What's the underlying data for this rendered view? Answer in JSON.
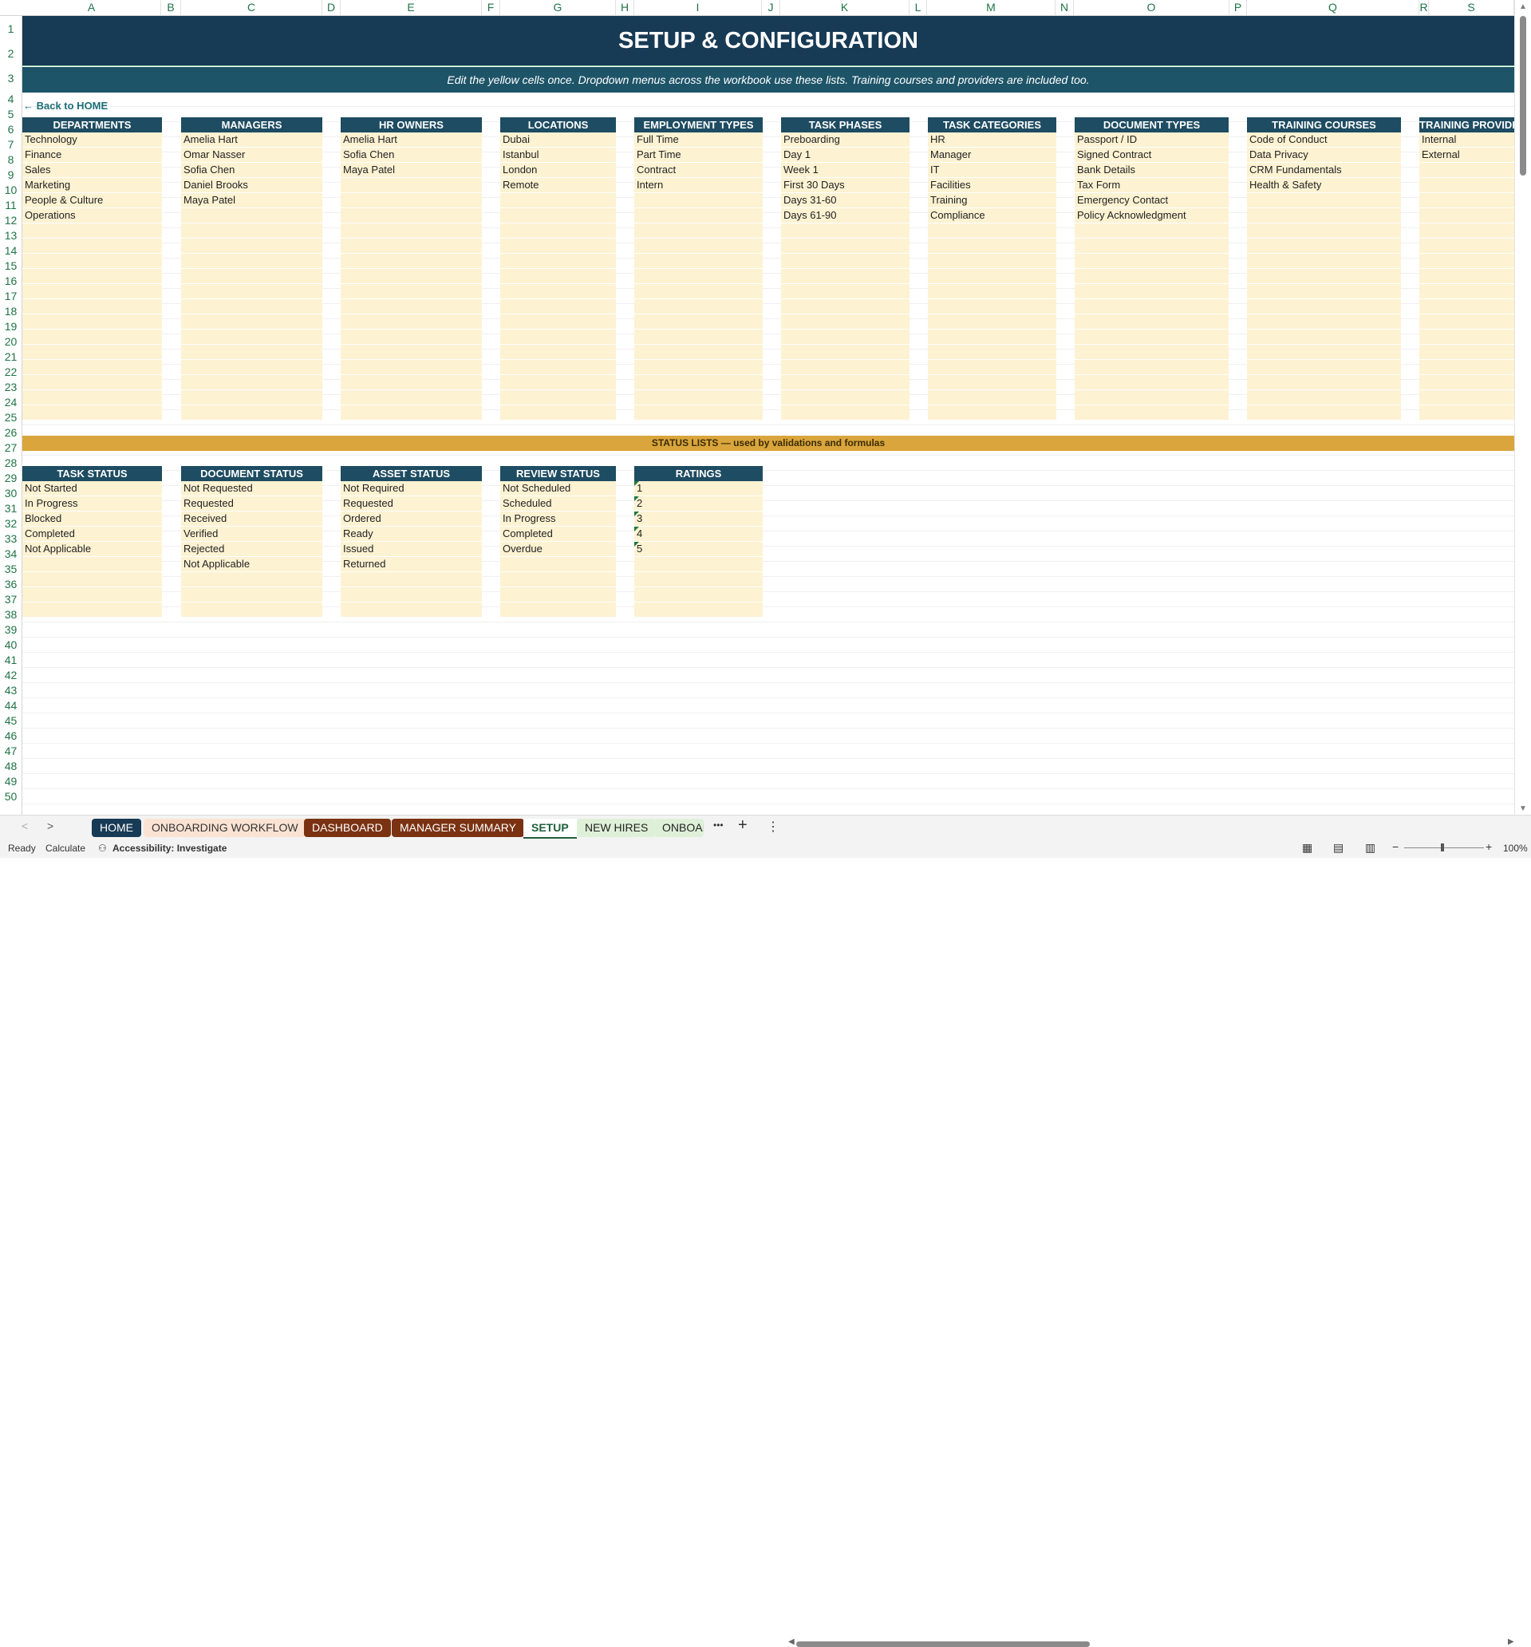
{
  "columns": [
    "A",
    "B",
    "C",
    "D",
    "E",
    "F",
    "G",
    "H",
    "I",
    "J",
    "K",
    "L",
    "M",
    "N",
    "O",
    "P",
    "Q",
    "R",
    "S"
  ],
  "rows": [
    "1",
    "2",
    "3",
    "4",
    "5",
    "6",
    "7",
    "8",
    "9",
    "10",
    "11",
    "12",
    "13",
    "14",
    "15",
    "16",
    "17",
    "18",
    "19",
    "20",
    "21",
    "22",
    "23",
    "24",
    "25",
    "26",
    "27",
    "28",
    "29",
    "30",
    "31",
    "32",
    "33",
    "34",
    "35",
    "36",
    "37",
    "38",
    "39",
    "40",
    "41",
    "42",
    "43",
    "44",
    "45",
    "46",
    "47",
    "48",
    "49",
    "50"
  ],
  "title": "SETUP & CONFIGURATION",
  "subtitle": "Edit the yellow cells once. Dropdown menus across the workbook use these lists. Training courses and providers are included too.",
  "back_link": "← Back to HOME",
  "lists": [
    {
      "header": "DEPARTMENTS",
      "items": [
        "Technology",
        "Finance",
        "Sales",
        "Marketing",
        "People & Culture",
        "Operations"
      ]
    },
    {
      "header": "MANAGERS",
      "items": [
        "Amelia Hart",
        "Omar Nasser",
        "Sofia Chen",
        "Daniel Brooks",
        "Maya Patel"
      ]
    },
    {
      "header": "HR OWNERS",
      "items": [
        "Amelia Hart",
        "Sofia Chen",
        "Maya Patel"
      ]
    },
    {
      "header": "LOCATIONS",
      "items": [
        "Dubai",
        "Istanbul",
        "London",
        "Remote"
      ]
    },
    {
      "header": "EMPLOYMENT TYPES",
      "items": [
        "Full Time",
        "Part Time",
        "Contract",
        "Intern"
      ]
    },
    {
      "header": "TASK PHASES",
      "items": [
        "Preboarding",
        "Day 1",
        "Week 1",
        "First 30 Days",
        "Days 31-60",
        "Days 61-90"
      ]
    },
    {
      "header": "TASK CATEGORIES",
      "items": [
        "HR",
        "Manager",
        "IT",
        "Facilities",
        "Training",
        "Compliance"
      ]
    },
    {
      "header": "DOCUMENT TYPES",
      "items": [
        "Passport / ID",
        "Signed Contract",
        "Bank Details",
        "Tax Form",
        "Emergency Contact",
        "Policy Acknowledgment"
      ]
    },
    {
      "header": "TRAINING COURSES",
      "items": [
        "Code of Conduct",
        "Data Privacy",
        "CRM Fundamentals",
        "Health & Safety"
      ]
    },
    {
      "header": "TRAINING PROVIDERS",
      "items": [
        "Internal",
        "External"
      ]
    }
  ],
  "status_band": "STATUS LISTS — used by validations and formulas",
  "status_lists": [
    {
      "header": "TASK STATUS",
      "items": [
        "Not Started",
        "In Progress",
        "Blocked",
        "Completed",
        "Not Applicable"
      ]
    },
    {
      "header": "DOCUMENT STATUS",
      "items": [
        "Not Requested",
        "Requested",
        "Received",
        "Verified",
        "Rejected",
        "Not Applicable"
      ]
    },
    {
      "header": "ASSET STATUS",
      "items": [
        "Not Required",
        "Requested",
        "Ordered",
        "Ready",
        "Issued",
        "Returned"
      ]
    },
    {
      "header": "REVIEW STATUS",
      "items": [
        "Not Scheduled",
        "Scheduled",
        "In Progress",
        "Completed",
        "Overdue"
      ]
    },
    {
      "header": "RATINGS",
      "items": [
        "1",
        "2",
        "3",
        "4",
        "5"
      ]
    }
  ],
  "tabs": [
    {
      "label": "HOME",
      "bg": "#173a55",
      "fg": "#ffffff"
    },
    {
      "label": "ONBOARDING WORKFLOW",
      "bg": "#fbe3d3",
      "fg": "#333333"
    },
    {
      "label": "DASHBOARD",
      "bg": "#7a3212",
      "fg": "#ffffff"
    },
    {
      "label": "MANAGER SUMMARY",
      "bg": "#7a3212",
      "fg": "#ffffff"
    },
    {
      "label": "SETUP",
      "bg": "#ffffff",
      "fg": "#1e5f3a",
      "active": true
    },
    {
      "label": "NEW HIRES",
      "bg": "#dff0d8",
      "fg": "#222222"
    },
    {
      "label": "ONBOAI",
      "bg": "#dff0d8",
      "fg": "#222222"
    }
  ],
  "tab_more": "•••",
  "status": {
    "ready": "Ready",
    "calculate": "Calculate",
    "accessibility": "Accessibility: Investigate",
    "zoom": "100%"
  }
}
